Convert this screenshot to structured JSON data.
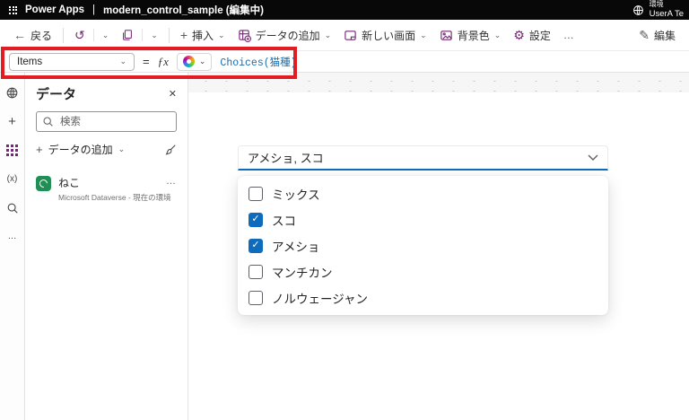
{
  "colors": {
    "accent": "#0f6cbd",
    "brand": "#742774",
    "annotation_red": "#e11d23",
    "topbar_bg": "#080808",
    "dataverse_green": "#1f8f55",
    "formula_blue": "#1b6ca8"
  },
  "icons": {
    "back": "←",
    "undo": "↺",
    "chevron_down": "⌄",
    "plus": "+",
    "equals": "=",
    "fx": "ƒx",
    "variables": "(x)",
    "more": "…",
    "close": "✕",
    "check": "✓",
    "gear": "⚙",
    "pencil": "✎",
    "ellipsis": "…"
  },
  "top_bar": {
    "app_name": "Power Apps",
    "separator": "|",
    "document_title": "modern_control_sample (編集中)",
    "environment_label": "環境",
    "user_name": "UserA Te"
  },
  "toolbar": {
    "back_label": "戻る",
    "insert_label": "挿入",
    "add_data_label": "データの追加",
    "new_screen_label": "新しい画面",
    "background_color_label": "背景色",
    "settings_label": "設定",
    "edit_label": "編集"
  },
  "formula_bar": {
    "property_selector": "Items",
    "formula": "Choices(猫種)"
  },
  "data_panel": {
    "title": "データ",
    "search_placeholder": "検索",
    "add_data_label": "データの追加",
    "items": [
      {
        "name": "ねこ",
        "source": "Microsoft Dataverse - 現在の環境"
      }
    ]
  },
  "canvas": {
    "combobox_value": "アメショ, スコ",
    "dropdown_options": [
      {
        "label": "ミックス",
        "checked": false
      },
      {
        "label": "スコ",
        "checked": true
      },
      {
        "label": "アメショ",
        "checked": true
      },
      {
        "label": "マンチカン",
        "checked": false
      },
      {
        "label": "ノルウェージャン",
        "checked": false
      }
    ]
  }
}
